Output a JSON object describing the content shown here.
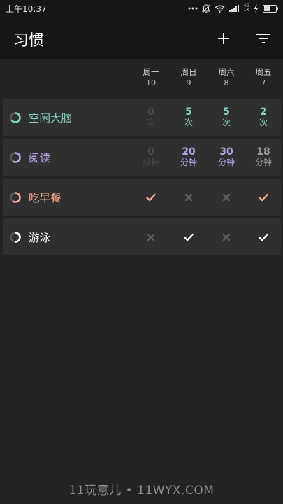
{
  "status_bar": {
    "time": "上午10:37",
    "net_top": "4G",
    "net_bottom": "1X"
  },
  "app": {
    "title": "习惯"
  },
  "icons": {
    "add": "plus-icon",
    "filter": "filter-icon"
  },
  "days": [
    {
      "weekday": "周一",
      "date": "10"
    },
    {
      "weekday": "周日",
      "date": "9"
    },
    {
      "weekday": "周六",
      "date": "8"
    },
    {
      "weekday": "周五",
      "date": "7"
    }
  ],
  "habits": [
    {
      "name": "空闲大脑",
      "color": "#7fd1c4",
      "type": "numeric",
      "ring_progress": 0.65,
      "cells": [
        {
          "value": "0",
          "unit": "次",
          "active": false
        },
        {
          "value": "5",
          "unit": "次",
          "active": true
        },
        {
          "value": "5",
          "unit": "次",
          "active": true
        },
        {
          "value": "2",
          "unit": "次",
          "active": true
        }
      ]
    },
    {
      "name": "阅读",
      "color": "#b7a1e6",
      "type": "numeric",
      "ring_progress": 0.6,
      "cells": [
        {
          "value": "0",
          "unit": "分钟",
          "active": false
        },
        {
          "value": "20",
          "unit": "分钟",
          "active": true
        },
        {
          "value": "30",
          "unit": "分钟",
          "active": true
        },
        {
          "value": "18",
          "unit": "分钟",
          "active": "dim"
        }
      ]
    },
    {
      "name": "吃早餐",
      "color": "#f2a68a",
      "type": "boolean",
      "ring_progress": 0.6,
      "cells": [
        {
          "done": true
        },
        {
          "done": false
        },
        {
          "done": false
        },
        {
          "done": true
        }
      ]
    },
    {
      "name": "游泳",
      "color": "#ffffff",
      "type": "boolean",
      "ring_progress": 0.5,
      "cells": [
        {
          "done": false
        },
        {
          "done": true
        },
        {
          "done": false
        },
        {
          "done": true
        }
      ]
    }
  ],
  "watermark": "11玩意儿 • 11WYX.COM"
}
